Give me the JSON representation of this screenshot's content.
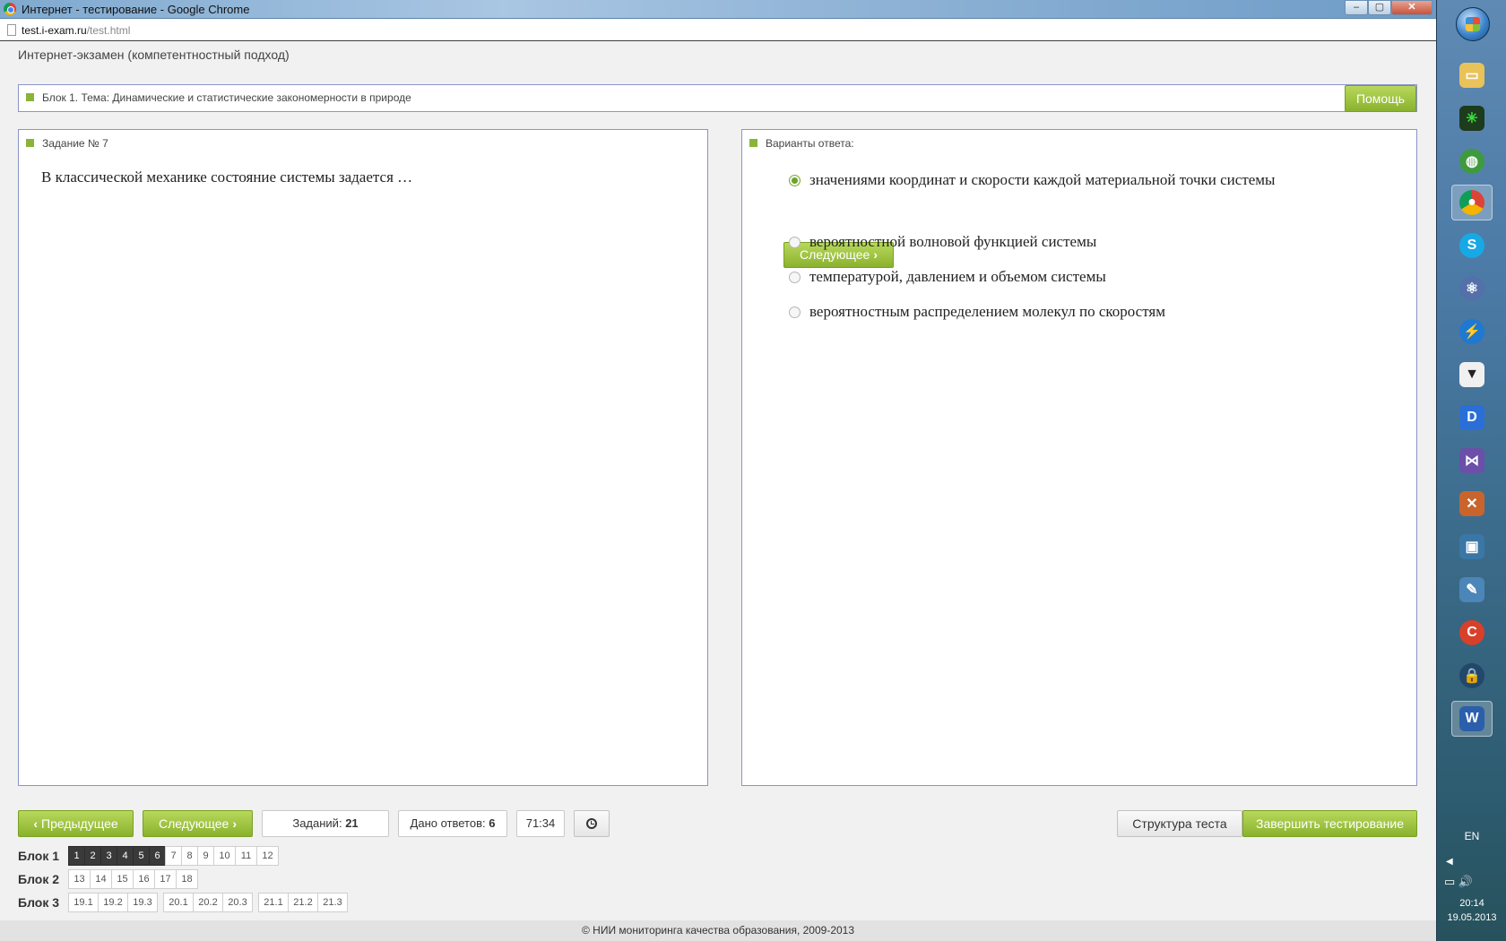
{
  "window": {
    "title": "Интернет - тестирование - Google Chrome",
    "url_host": "test.i-exam.ru",
    "url_path": "/test.html",
    "buttons": {
      "minimize": "–",
      "maximize": "▢",
      "close": "✕"
    }
  },
  "exam": {
    "title": "Интернет-экзамен (компетентностный подход)",
    "topic": "Блок 1. Тема: Динамические и статистические закономерности в природе",
    "help_label": "Помощь"
  },
  "question": {
    "header": "Задание № 7",
    "text": "В классической механике состояние системы задается …"
  },
  "answers": {
    "header": "Варианты ответа:",
    "options": [
      {
        "text": "значениями координат и скорости каждой материальной точки системы",
        "selected": true
      },
      {
        "text": "вероятностной волновой функцией системы",
        "selected": false
      },
      {
        "text": "температурой, давлением и объемом системы",
        "selected": false
      },
      {
        "text": "вероятностным распределением молекул по скоростям",
        "selected": false
      }
    ],
    "next_inline_label": "Следующее"
  },
  "toolbar": {
    "prev_label": "Предыдущее",
    "next_label": "Следующее",
    "tasks_label": "Заданий:",
    "tasks_value": "21",
    "answers_label": "Дано ответов:",
    "answers_value": "6",
    "timer": "71:34",
    "structure_label": "Структура теста",
    "finish_label": "Завершить тестирование"
  },
  "blocks": [
    {
      "label": "Блок 1",
      "items": [
        "1",
        "2",
        "3",
        "4",
        "5",
        "6",
        "7",
        "8",
        "9",
        "10",
        "11",
        "12"
      ],
      "done": 6
    },
    {
      "label": "Блок 2",
      "items": [
        "13",
        "14",
        "15",
        "16",
        "17",
        "18"
      ],
      "done": 0
    },
    {
      "label": "Блок 3",
      "items": [
        "19.1",
        "19.2",
        "19.3",
        "20.1",
        "20.2",
        "20.3",
        "21.1",
        "21.2",
        "21.3"
      ],
      "done": 0
    }
  ],
  "footer": "© НИИ мониторинга качества образования, 2009-2013",
  "taskbar": {
    "lang": "EN",
    "time": "20:14",
    "date": "19.05.2013",
    "apps": [
      "folder-icon",
      "network-icon",
      "globe-icon",
      "chrome-icon",
      "skype-icon",
      "atom-icon",
      "lightning-icon",
      "fox-icon",
      "d-app-icon",
      "visual-studio-icon",
      "shield-app-icon",
      "monitor-app-icon",
      "tools-app-icon",
      "ccleaner-icon",
      "lock-icon",
      "word-icon"
    ]
  },
  "colors": {
    "accent_green": "#8bb33a",
    "panel_border": "#8a94c8",
    "done_chip": "#3a3a3a"
  }
}
